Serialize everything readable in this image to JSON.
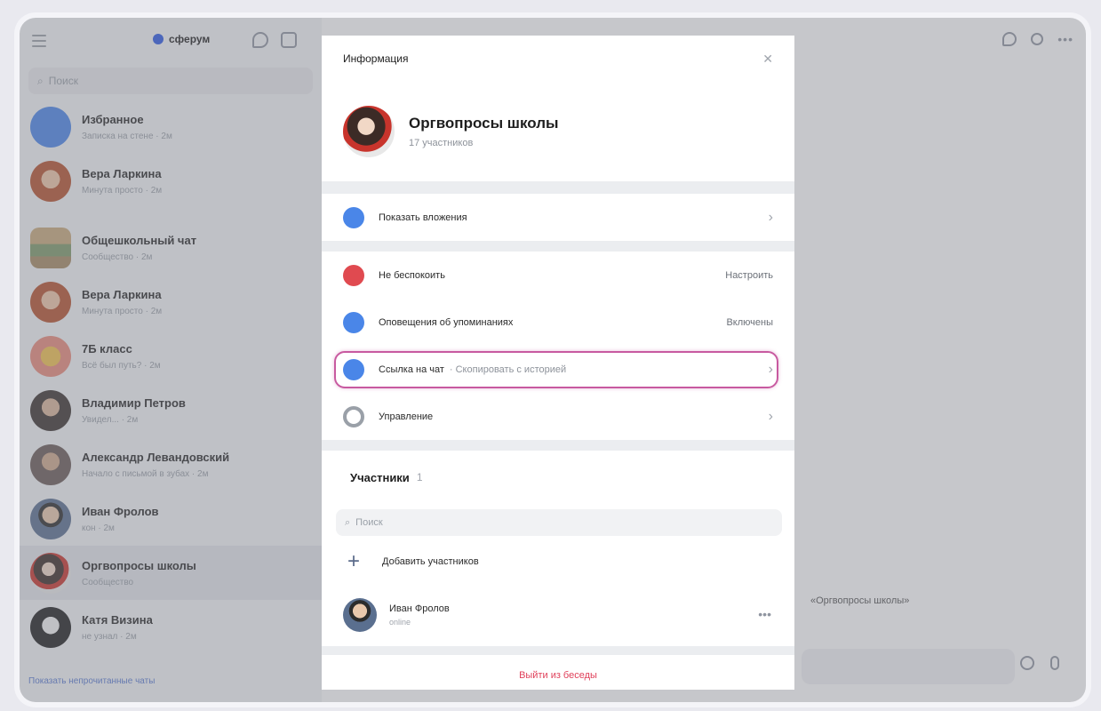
{
  "app": {
    "logo_text": "сферум"
  },
  "sidebar": {
    "search_placeholder": "Поиск",
    "chats": [
      {
        "name": "Избранное",
        "sub": "Записка на стене · 2м"
      },
      {
        "name": "Вера Ларкина",
        "sub": "Минута просто · 2м"
      },
      {
        "name": "Общешкольный чат",
        "sub": "Сообщество · 2м"
      },
      {
        "name": "Вера Ларкина",
        "sub": "Минута просто · 2м"
      },
      {
        "name": "7Б класс",
        "sub": "Всё был путь? · 2м"
      },
      {
        "name": "Владимир Петров",
        "sub": "Увидел... · 2м"
      },
      {
        "name": "Александр Левандовский",
        "sub": "Начало с письмой в зубах · 2м"
      },
      {
        "name": "Иван Фролов",
        "sub": "кон · 2м"
      },
      {
        "name": "Оргвопросы школы",
        "sub": "Сообщество"
      },
      {
        "name": "Катя Визина",
        "sub": "не узнал · 2м"
      }
    ],
    "bottom_link": "Показать непрочитанные чаты"
  },
  "chat_area": {
    "background_message": "«Оргвопросы школы»"
  },
  "modal": {
    "title": "Информация",
    "profile": {
      "name": "Оргвопросы школы",
      "count": "17 участников"
    },
    "attachments_label": "Показать вложения",
    "settings": {
      "dnd_label": "Не беспокоить",
      "dnd_value": "Настроить",
      "mentions_label": "Оповещения об упоминаниях",
      "mentions_value": "Включены",
      "link_label": "Ссылка на чат",
      "link_sub": "· Скопировать с историей",
      "manage_label": "Управление"
    },
    "members": {
      "title": "Участники",
      "count": "1",
      "search_placeholder": "Поиск",
      "add_label": "Добавить участников",
      "list": [
        {
          "name": "Иван Фролов",
          "status": "online"
        }
      ]
    },
    "leave_label": "Выйти из беседы"
  },
  "colors": {
    "accent_blue": "#4a86e8",
    "dnd_red": "#e04a50",
    "highlight_pink": "#c85aa0",
    "leave_red": "#e0405a"
  }
}
